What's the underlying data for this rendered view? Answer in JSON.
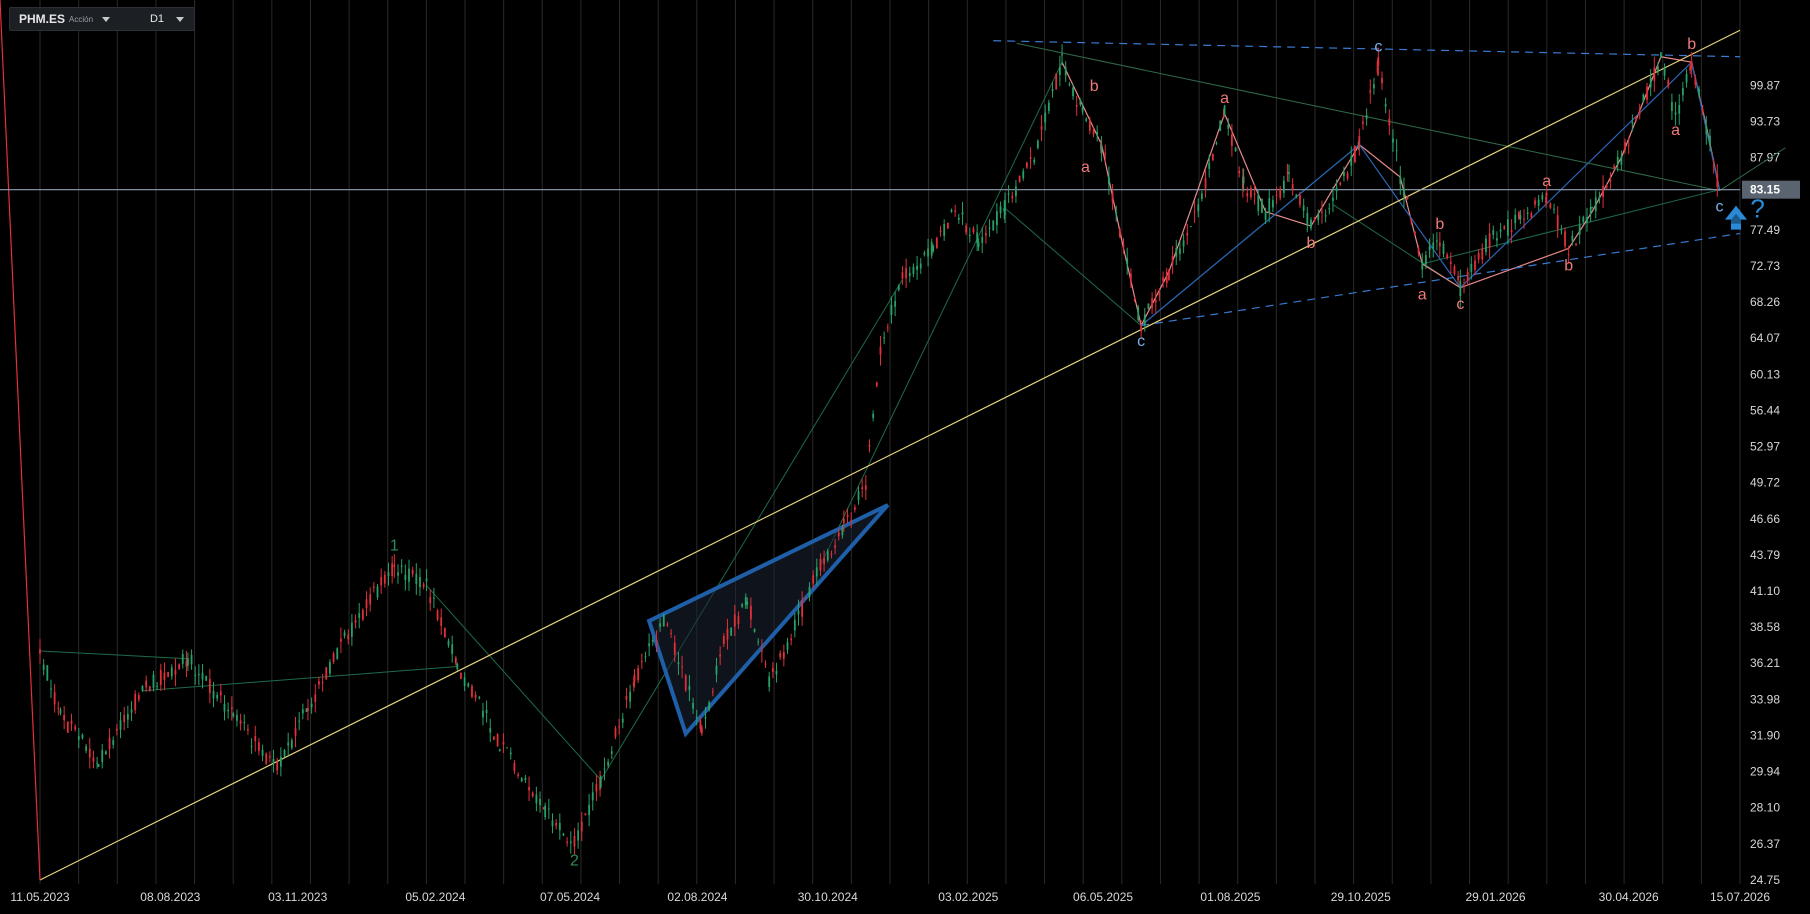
{
  "toolbar": {
    "symbol": "PHM.ES",
    "instrument_type": "Acción",
    "timeframe": "D1"
  },
  "icons": {
    "symbol_dropdown": "chevron-down-icon",
    "timeframe_dropdown": "chevron-down-icon",
    "forecast_arrow": "double-arrow-up-icon"
  },
  "colors": {
    "background": "#000000",
    "up_candle": "#26a269",
    "down_candle": "#e0303a",
    "trendline": "#e8d27a",
    "wave_channel": "#1f5fa8",
    "correction_labels": "#f07a7a",
    "impulse_labels": "#2e8b57",
    "price_line": "#8ea0b4",
    "grid": "#2a2a2a"
  },
  "chart_data": {
    "type": "candlestick",
    "symbol": "PHM.ES",
    "timeframe": "D1",
    "y_axis": {
      "scale": "log",
      "range": [
        24.75,
        112
      ],
      "ticks": [
        "99.87",
        "93.73",
        "87.97",
        "83.15",
        "77.49",
        "72.73",
        "68.26",
        "64.07",
        "60.13",
        "56.44",
        "52.97",
        "49.72",
        "46.66",
        "43.79",
        "41.10",
        "38.58",
        "36.21",
        "33.98",
        "31.90",
        "29.94",
        "28.10",
        "26.37",
        "24.75"
      ]
    },
    "x_axis": {
      "range": [
        "2023-05-11",
        "2026-07-15"
      ],
      "ticks": [
        "11.05.2023",
        "08.08.2023",
        "03.11.2023",
        "05.02.2024",
        "07.05.2024",
        "02.08.2024",
        "30.10.2024",
        "03.02.2025",
        "06.05.2025",
        "01.08.2025",
        "29.10.2025",
        "29.01.2026",
        "30.04.2026",
        "15.07.2026"
      ]
    },
    "current_price": "83.15",
    "price_path": [
      [
        "2023-05-11",
        37.0
      ],
      [
        "2023-05-25",
        33.0
      ],
      [
        "2023-06-20",
        30.5
      ],
      [
        "2023-07-20",
        34.5
      ],
      [
        "2023-08-20",
        36.5
      ],
      [
        "2023-09-20",
        33.0
      ],
      [
        "2023-10-20",
        30.0
      ],
      [
        "2023-11-10",
        33.5
      ],
      [
        "2023-12-10",
        38.5
      ],
      [
        "2024-01-08",
        43.0
      ],
      [
        "2024-01-30",
        41.5
      ],
      [
        "2024-02-20",
        36.0
      ],
      [
        "2024-03-20",
        31.5
      ],
      [
        "2024-04-20",
        28.0
      ],
      [
        "2024-05-10",
        26.4
      ],
      [
        "2024-05-28",
        29.5
      ],
      [
        "2024-06-20",
        35.0
      ],
      [
        "2024-07-10",
        39.0
      ],
      [
        "2024-07-25",
        35.0
      ],
      [
        "2024-08-05",
        32.0
      ],
      [
        "2024-08-20",
        37.5
      ],
      [
        "2024-09-05",
        40.5
      ],
      [
        "2024-09-20",
        35.0
      ],
      [
        "2024-10-05",
        38.0
      ],
      [
        "2024-10-25",
        43.0
      ],
      [
        "2024-11-10",
        46.0
      ],
      [
        "2024-11-25",
        49.5
      ],
      [
        "2024-12-05",
        63.0
      ],
      [
        "2024-12-20",
        71.0
      ],
      [
        "2025-01-10",
        75.0
      ],
      [
        "2025-01-25",
        80.0
      ],
      [
        "2025-02-10",
        76.0
      ],
      [
        "2025-02-28",
        80.5
      ],
      [
        "2025-03-20",
        88.0
      ],
      [
        "2025-04-08",
        104.0
      ],
      [
        "2025-04-22",
        95.0
      ],
      [
        "2025-05-05",
        90.0
      ],
      [
        "2025-05-20",
        75.0
      ],
      [
        "2025-06-01",
        65.5
      ],
      [
        "2025-06-20",
        72.0
      ],
      [
        "2025-07-10",
        80.0
      ],
      [
        "2025-07-28",
        95.0
      ],
      [
        "2025-08-10",
        84.0
      ],
      [
        "2025-08-25",
        80.0
      ],
      [
        "2025-09-10",
        85.0
      ],
      [
        "2025-09-25",
        78.0
      ],
      [
        "2025-10-10",
        81.0
      ],
      [
        "2025-10-28",
        90.0
      ],
      [
        "2025-11-10",
        103.5
      ],
      [
        "2025-11-25",
        85.0
      ],
      [
        "2025-12-10",
        73.0
      ],
      [
        "2025-12-22",
        76.0
      ],
      [
        "2026-01-05",
        70.0
      ],
      [
        "2026-01-25",
        76.0
      ],
      [
        "2026-02-15",
        79.0
      ],
      [
        "2026-03-05",
        82.0
      ],
      [
        "2026-03-20",
        75.0
      ],
      [
        "2026-04-05",
        80.0
      ],
      [
        "2026-04-25",
        88.0
      ],
      [
        "2026-05-10",
        97.0
      ],
      [
        "2026-05-22",
        105.0
      ],
      [
        "2026-06-01",
        94.0
      ],
      [
        "2026-06-12",
        104.0
      ],
      [
        "2026-06-22",
        93.0
      ],
      [
        "2026-07-01",
        83.15
      ]
    ],
    "annotations": [
      {
        "text": "1",
        "date": "2024-01-08",
        "price": 43.5,
        "color": "impulse",
        "pos": "above"
      },
      {
        "text": "2",
        "date": "2024-05-10",
        "price": 26.2,
        "color": "impulse",
        "pos": "below"
      },
      {
        "text": "b",
        "date": "2025-04-30",
        "price": 97.5,
        "color": "correction",
        "pos": "above"
      },
      {
        "text": "a",
        "date": "2025-04-24",
        "price": 88.5,
        "color": "correction",
        "pos": "below"
      },
      {
        "text": "c",
        "date": "2025-06-01",
        "price": 65.2,
        "color": "blue",
        "pos": "below"
      },
      {
        "text": "a",
        "date": "2025-07-28",
        "price": 95.5,
        "color": "correction",
        "pos": "above"
      },
      {
        "text": "b",
        "date": "2025-09-25",
        "price": 77.5,
        "color": "correction",
        "pos": "below"
      },
      {
        "text": "c",
        "date": "2025-11-10",
        "price": 104.5,
        "color": "blue",
        "pos": "above"
      },
      {
        "text": "b",
        "date": "2025-12-22",
        "price": 76.5,
        "color": "correction",
        "pos": "above"
      },
      {
        "text": "a",
        "date": "2025-12-10",
        "price": 70.8,
        "color": "correction",
        "pos": "below"
      },
      {
        "text": "c",
        "date": "2026-01-05",
        "price": 69.6,
        "color": "correction",
        "pos": "below"
      },
      {
        "text": "a",
        "date": "2026-03-05",
        "price": 82.5,
        "color": "correction",
        "pos": "above"
      },
      {
        "text": "b",
        "date": "2026-03-20",
        "price": 74.5,
        "color": "correction",
        "pos": "below"
      },
      {
        "text": "b",
        "date": "2026-06-12",
        "price": 105.0,
        "color": "correction",
        "pos": "above"
      },
      {
        "text": "a",
        "date": "2026-06-01",
        "price": 94.5,
        "color": "correction",
        "pos": "below"
      },
      {
        "text": "c",
        "date": "2026-07-01",
        "price": 82.6,
        "color": "blue",
        "pos": "below"
      },
      {
        "text": "?",
        "date": "2026-07-27",
        "price": 80.0,
        "color": "blue",
        "pos": "center"
      }
    ],
    "trendlines": [
      {
        "kind": "support",
        "from": [
          "2023-05-11",
          24.75
        ],
        "to": [
          "2026-07-15",
          110.0
        ]
      },
      {
        "kind": "lower-channel",
        "from": [
          "2025-06-01",
          65.5
        ],
        "to": [
          "2026-07-15",
          77.0
        ],
        "dashed": true
      },
      {
        "kind": "upper-channel",
        "from": [
          "2025-02-20",
          108.0
        ],
        "to": [
          "2026-07-15",
          105.0
        ],
        "dashed": true
      },
      {
        "kind": "wave-triangle",
        "points": [
          [
            "2024-06-30",
            39.0
          ],
          [
            "2024-07-25",
            32.0
          ],
          [
            "2024-12-10",
            47.8
          ]
        ]
      }
    ]
  }
}
